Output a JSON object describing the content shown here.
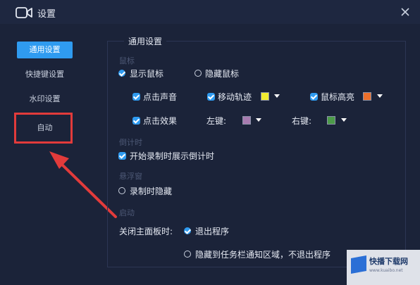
{
  "window": {
    "title": "设置"
  },
  "sidebar": {
    "items": [
      {
        "label": "通用设置",
        "active": true
      },
      {
        "label": "快捷键设置",
        "active": false
      },
      {
        "label": "水印设置",
        "active": false
      },
      {
        "label": "自动",
        "active": false
      }
    ]
  },
  "panel": {
    "title": "通用设置",
    "mouse_section": "鼠标",
    "show_cursor": "显示鼠标",
    "hide_cursor": "隐藏鼠标",
    "click_sound": "点击声音",
    "move_trail": "移动轨迹",
    "cursor_highlight": "鼠标高亮",
    "click_effect": "点击效果",
    "left_key": "左键:",
    "right_key": "右键:",
    "countdown_section": "倒计时",
    "show_countdown": "开始录制时展示倒计时",
    "float_section": "悬浮窗",
    "hide_when_recording": "录制时隐藏",
    "startup_section": "启动",
    "close_main_label": "关闭主面板时:",
    "exit_program": "退出程序",
    "hide_to_tray": "隐藏到任务栏通知区域，不退出程序"
  },
  "colors": {
    "accent": "#2f9bf0",
    "trail": "#f2ec30",
    "highlight": "#ec6f2b",
    "left_click": "#a77bb0",
    "right_click": "#4c9b49",
    "annotation": "#e23b3b"
  },
  "watermark": {
    "brand": "快播下载网",
    "url": "www.kuaibo.net"
  }
}
